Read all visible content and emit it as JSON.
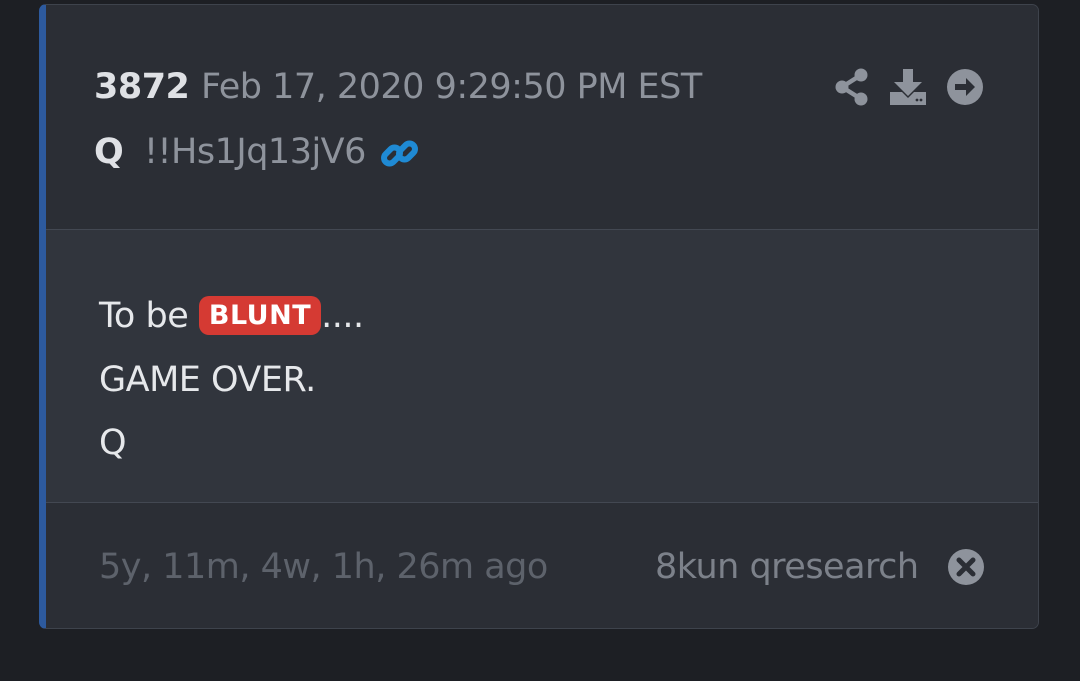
{
  "post": {
    "number": "3872",
    "timestamp": "Feb 17, 2020 9:29:50 PM EST",
    "author": "Q",
    "tripcode": "!!Hs1Jq13jV6"
  },
  "icons": {
    "link": "link-icon",
    "share": "share-icon",
    "download": "download-icon",
    "open": "arrow-right-circle-icon",
    "close": "close-circle-icon"
  },
  "body": {
    "line1_prefix": "To be ",
    "badge": "BLUNT",
    "line1_suffix": "....",
    "line2": "GAME OVER.",
    "line3": "Q"
  },
  "footer": {
    "age": "5y, 11m, 4w, 1h, 26m ago",
    "source": "8kun qresearch"
  },
  "colors": {
    "accent_bar": "#2d5a9e",
    "link": "#1f8ad4",
    "badge": "#d53a33",
    "card_bg": "#2c2f36",
    "page_bg": "#1d1f24"
  }
}
